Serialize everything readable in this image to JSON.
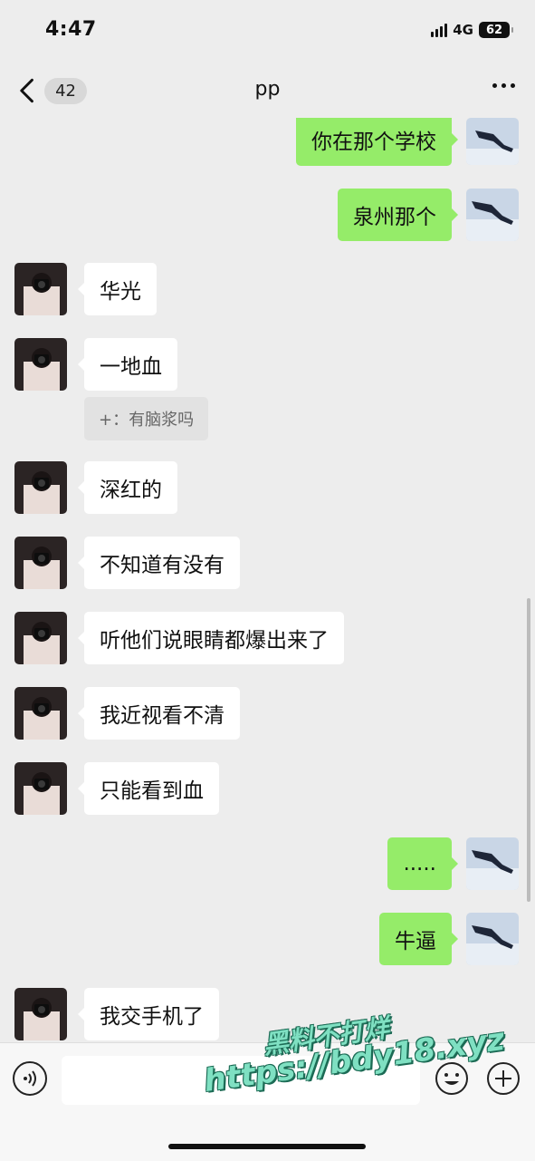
{
  "status_bar": {
    "time": "4:47",
    "network": "4G",
    "battery": "62"
  },
  "nav": {
    "back_count": "42",
    "title": "pp"
  },
  "messages": [
    {
      "side": "out",
      "text": "你在那个学校"
    },
    {
      "side": "out",
      "text": "泉州那个"
    },
    {
      "side": "in",
      "text": "华光"
    },
    {
      "side": "in",
      "text": "一地血"
    },
    {
      "side": "in-quote",
      "text": "+：有脑浆吗"
    },
    {
      "side": "in",
      "text": "深红的"
    },
    {
      "side": "in",
      "text": "不知道有没有"
    },
    {
      "side": "in",
      "text": "听他们说眼睛都爆出来了"
    },
    {
      "side": "in",
      "text": "我近视看不清"
    },
    {
      "side": "in",
      "text": "只能看到血"
    },
    {
      "side": "out",
      "text": "....."
    },
    {
      "side": "out",
      "text": "牛逼"
    },
    {
      "side": "in",
      "text": "我交手机了"
    }
  ],
  "input": {
    "value": ""
  },
  "watermark": {
    "line1": "黑料不打烊",
    "line2": "https://bdy18.xyz"
  },
  "colors": {
    "background": "#ededed",
    "out_bubble": "#95ec69",
    "in_bubble": "#ffffff"
  },
  "icons": [
    "back-chevron-icon",
    "more-icon",
    "voice-icon",
    "emoji-icon",
    "plus-icon",
    "signal-icon",
    "battery-icon"
  ]
}
